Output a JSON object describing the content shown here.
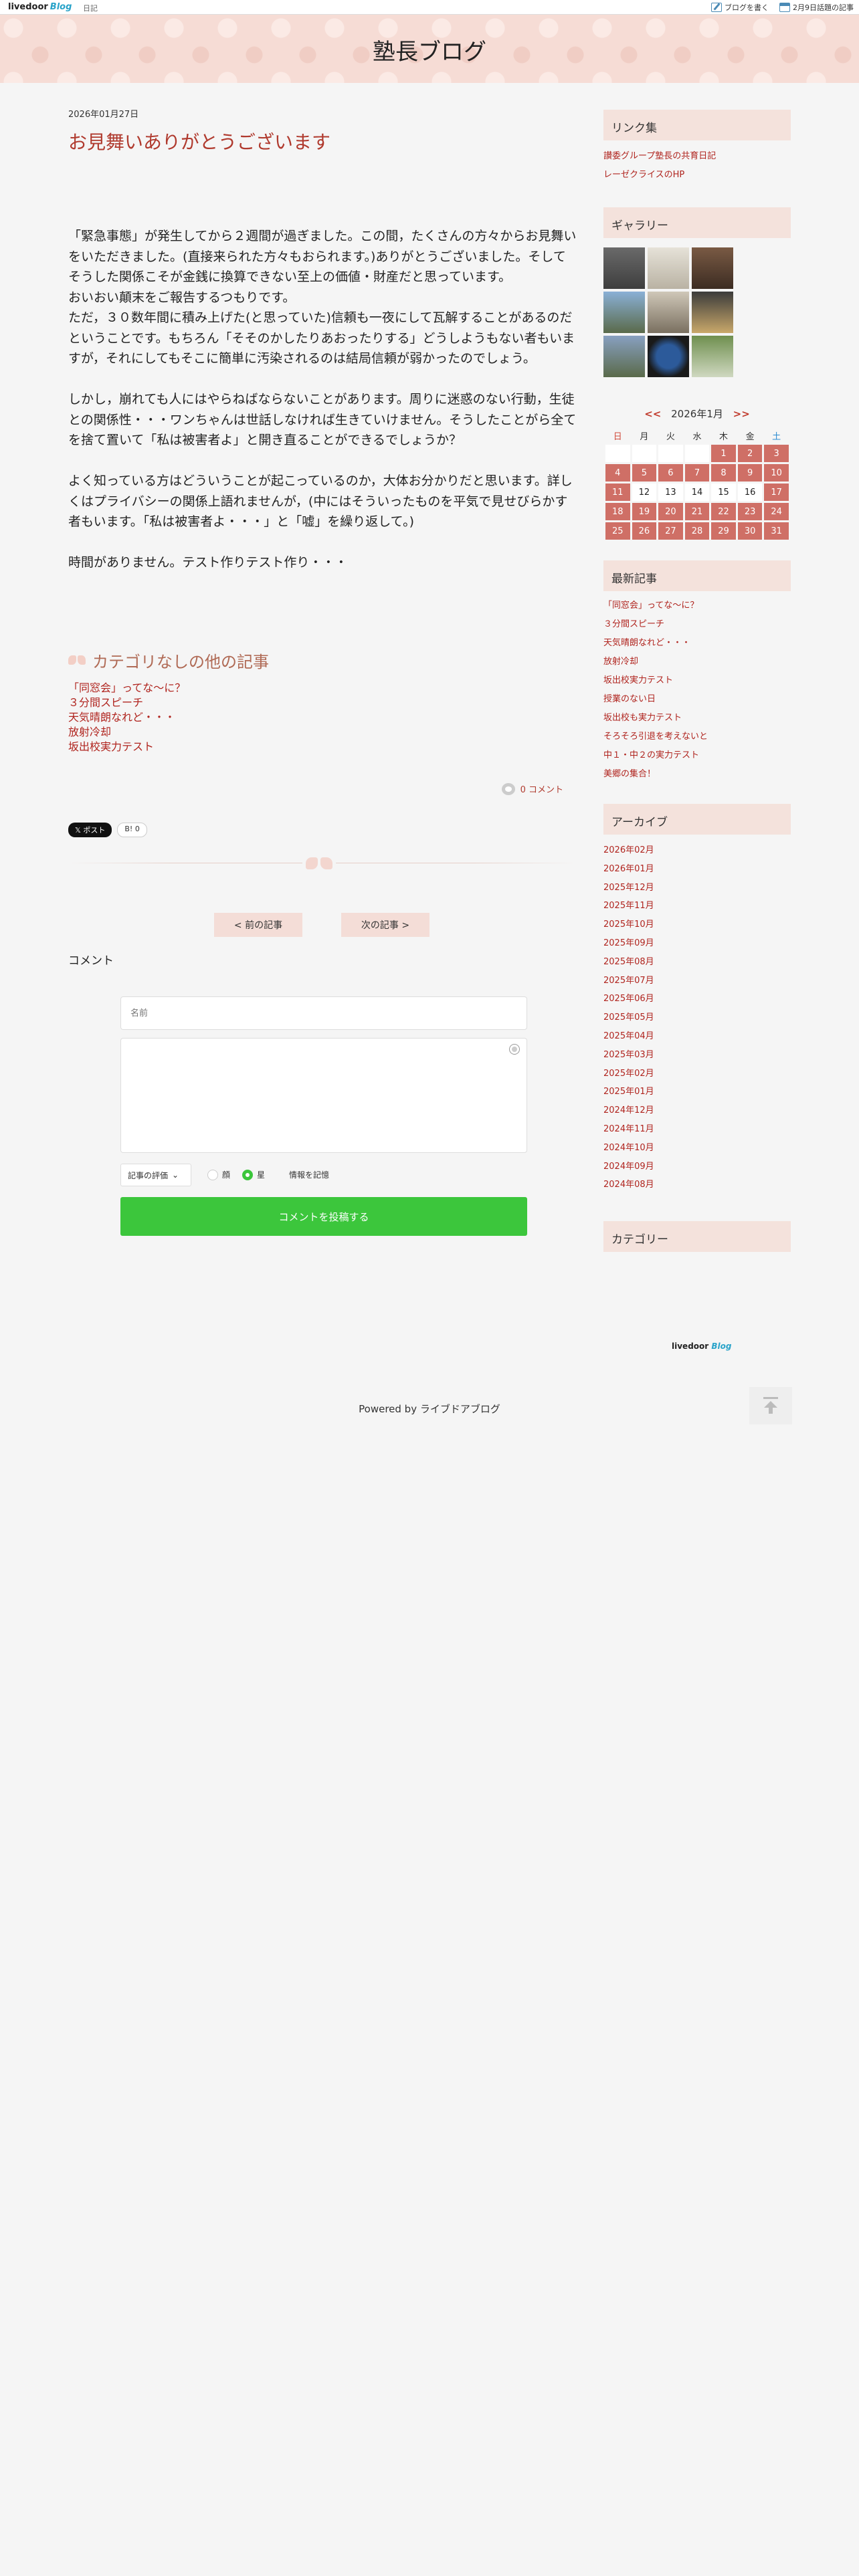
{
  "topbar": {
    "logo": "livedoor",
    "logo_blog": "Blog",
    "diary": "日記",
    "write_blog": "ブログを書く",
    "topic": "2月9日話題の記事"
  },
  "site": {
    "title": "塾長ブログ"
  },
  "post": {
    "date": "2026年01月27日",
    "title": "お見舞いありがとうございます",
    "paragraphs": [
      "「緊急事態」が発生してから２週間が過ぎました。この間，たくさんの方々からお見舞いをいただきました。(直接来られた方々もおられます。)ありがとうございました。そしてそうした関係こそが金銭に換算できない至上の価値・財産だと思っています。\nおいおい顛末をご報告するつもりです。\nただ，３０数年間に積み上げた(と思っていた)信頼も一夜にして瓦解することがあるのだということです。もちろん「そそのかしたりあおったりする」どうしようもない者もいますが，それにしてもそこに簡単に汚染されるのは結局信頼が弱かったのでしょう。",
      "しかし，崩れても人にはやらねばならないことがあります。周りに迷惑のない行動，生徒との関係性・・・ワンちゃんは世話しなければ生きていけません。そうしたことがら全てを捨て置いて「私は被害者よ」と開き直ることができるでしょうか？",
      "よく知っている方はどういうことが起こっているのか，大体お分かりだと思います。詳しくはプライバシーの関係上語れませんが，(中にはそういったものを平気で見せびらかす者もいます。「私は被害者よ・・・」と「嘘」を繰り返して。)",
      "時間がありません。テスト作りテスト作り・・・"
    ],
    "category_heading": "カテゴリなしの他の記事",
    "category_links": [
      "「同窓会」ってな〜に？",
      "３分間スピーチ",
      "天気晴朗なれど・・・",
      "放射冷却",
      "坂出校実力テスト"
    ],
    "comment_count": "0 コメント",
    "share_x": "ポスト",
    "share_hatena": "B!",
    "share_hatena_count": "0",
    "prev": "< 前の記事",
    "next": "次の記事 >",
    "comment_label": "コメント"
  },
  "form": {
    "name_placeholder": "名前",
    "rating_label": "記事の評価",
    "radio_face": "顔",
    "radio_star": "星",
    "remember": "情報を記憶",
    "submit": "コメントを投稿する"
  },
  "sidebar": {
    "links_heading": "リンク集",
    "links": [
      "讃委グループ塾長の共育日記",
      "レーゼクライスのHP"
    ],
    "gallery_heading": "ギャラリー",
    "calendar": {
      "prev": "<<",
      "month": "2026年1月",
      "next": ">>",
      "weekdays": [
        "日",
        "月",
        "火",
        "水",
        "木",
        "金",
        "土"
      ],
      "weeks": [
        [
          "",
          "",
          "",
          "",
          "1",
          "2",
          "3"
        ],
        [
          "4",
          "5",
          "6",
          "7",
          "8",
          "9",
          "10"
        ],
        [
          "11",
          "12",
          "13",
          "14",
          "15",
          "16",
          "17"
        ],
        [
          "18",
          "19",
          "20",
          "21",
          "22",
          "23",
          "24"
        ],
        [
          "25",
          "26",
          "27",
          "28",
          "29",
          "30",
          "31"
        ]
      ],
      "plain_days": [
        "12",
        "13",
        "14",
        "15",
        "16"
      ]
    },
    "recent_heading": "最新記事",
    "recent": [
      "「同窓会」ってな〜に？",
      "３分間スピーチ",
      "天気晴朗なれど・・・",
      "放射冷却",
      "坂出校実力テスト",
      "授業のない日",
      "坂出校も実力テスト",
      "そろそろ引退を考えないと",
      "中１・中２の実力テスト",
      "美郷の集合！"
    ],
    "archive_heading": "アーカイブ",
    "archives": [
      "2026年02月",
      "2026年01月",
      "2025年12月",
      "2025年11月",
      "2025年10月",
      "2025年09月",
      "2025年08月",
      "2025年07月",
      "2025年06月",
      "2025年05月",
      "2025年04月",
      "2025年03月",
      "2025年02月",
      "2025年01月",
      "2024年12月",
      "2024年11月",
      "2024年10月",
      "2024年09月",
      "2024年08月"
    ],
    "category_heading": "カテゴリー"
  },
  "footer": {
    "logo": "livedoor",
    "logo_blog": "Blog",
    "powered": "Powered by ライブドアブログ"
  }
}
